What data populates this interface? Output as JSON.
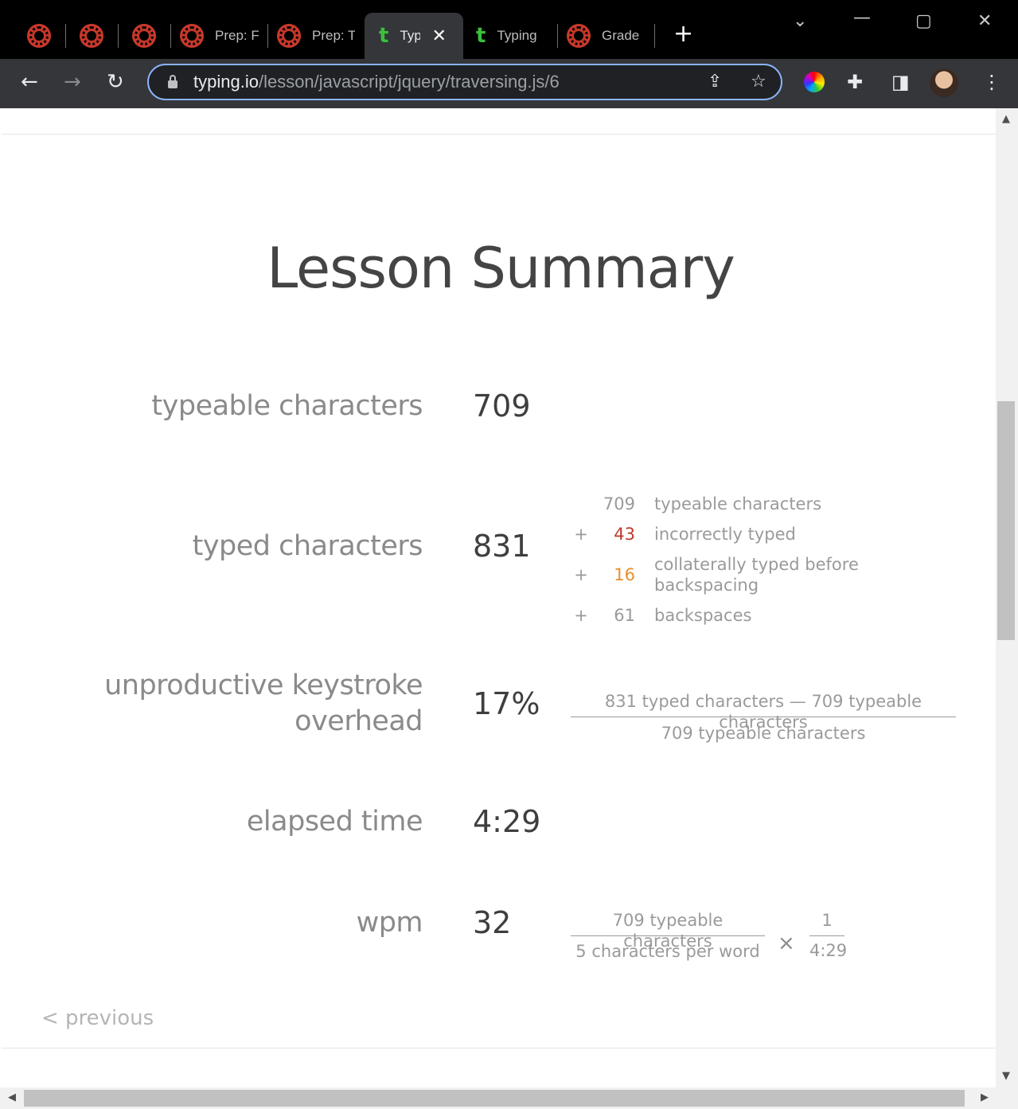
{
  "browser": {
    "tabs": [
      {
        "icon": "canvas-icon",
        "label": ""
      },
      {
        "icon": "canvas-icon",
        "label": ""
      },
      {
        "icon": "canvas-icon",
        "label": ""
      },
      {
        "icon": "canvas-icon",
        "label": "Prep: F"
      },
      {
        "icon": "canvas-icon",
        "label": "Prep: T"
      },
      {
        "icon": "typing-icon",
        "label": "Typ",
        "active": true
      },
      {
        "icon": "typing-icon",
        "label": "Typing"
      },
      {
        "icon": "canvas-icon",
        "label": "Grade"
      }
    ],
    "url_host": "typing.io",
    "url_path": "/lesson/javascript/jquery/traversing.js/6"
  },
  "page": {
    "title": "Lesson Summary",
    "stats": {
      "typeable_label": "typeable characters",
      "typeable_value": "709",
      "typed_label": "typed characters",
      "typed_value": "831",
      "overhead_label_line1": "unproductive keystroke",
      "overhead_label_line2": "overhead",
      "overhead_value": "17%",
      "elapsed_label": "elapsed time",
      "elapsed_value": "4:29",
      "wpm_label": "wpm",
      "wpm_value": "32"
    },
    "typed_breakdown": [
      {
        "op": "",
        "num": "709",
        "label": "typeable characters",
        "color": "#9a9a9a"
      },
      {
        "op": "+",
        "num": "43",
        "label": "incorrectly typed",
        "color": "#c0392b"
      },
      {
        "op": "+",
        "num": "16",
        "label": "collaterally typed before backspacing",
        "color": "#e8902a"
      },
      {
        "op": "+",
        "num": "61",
        "label": "backspaces",
        "color": "#9a9a9a"
      }
    ],
    "overhead_formula": {
      "numerator": "831 typed characters — 709 typeable characters",
      "denominator": "709 typeable characters"
    },
    "wpm_formula": {
      "numerator": "709 typeable characters",
      "denominator": "5 characters per word",
      "times": "×",
      "numerator2": "1",
      "denominator2": "4:29"
    },
    "previous_link": "< previous"
  }
}
